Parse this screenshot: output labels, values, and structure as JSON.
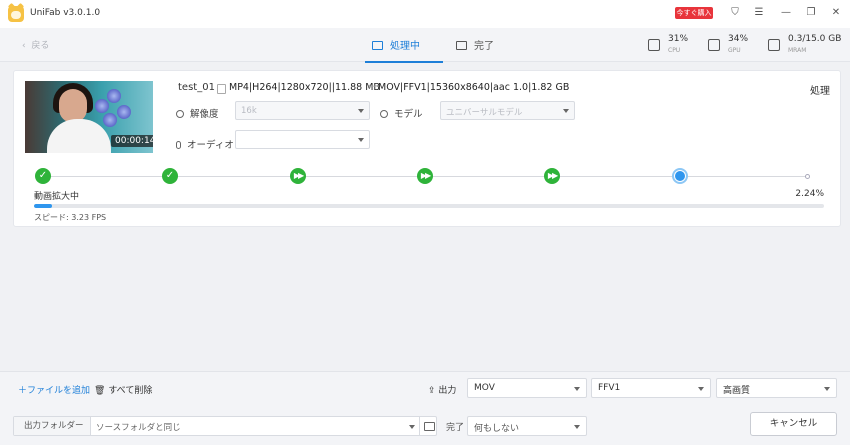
{
  "app": {
    "title": "UniFab v3.0.1.0",
    "buy_label": "今すぐ購入"
  },
  "nav": {
    "back_label": "戻る",
    "tabs": [
      {
        "label": "処理中"
      },
      {
        "label": "完了"
      }
    ],
    "stats": [
      {
        "value": "31%",
        "label": "CPU",
        "icon": "cpu-icon"
      },
      {
        "value": "34%",
        "label": "GPU",
        "icon": "gpu-icon"
      },
      {
        "value": "0.3/15.0 GB",
        "label": "MRAM",
        "icon": "memory-icon"
      }
    ]
  },
  "task": {
    "thumbnail_time": "00:00:14",
    "file_name": "test_01",
    "source_info": "MP4|H264|1280x720||11.88 MB",
    "arrow": "⟵",
    "target_info": "MOV|FFV1|15360x8640|aac 1.0|1.82 GB",
    "process_label": "処理",
    "resolution": {
      "label": "解像度",
      "value": "16k"
    },
    "model": {
      "label": "モデル",
      "value": "ユニバーサルモデル"
    },
    "audio": {
      "label": "オーディオ",
      "value": ""
    },
    "stage_label": "動画拡大中",
    "percent_label": "2.24%",
    "progress_fraction": 0.0224,
    "speed_label": "スピード: 3.23  FPS"
  },
  "bottom": {
    "add_file_label": "＋ファイルを追加",
    "delete_all_label": "すべて削除",
    "output_label": "出力",
    "format": "MOV",
    "codec": "FFV1",
    "quality": "高画質",
    "output_folder_label": "出力フォルダー",
    "output_folder_value": "ソースフォルダと同じ",
    "after_done_label": "完了",
    "after_done_value": "何もしない",
    "cancel_label": "キャンセル"
  }
}
